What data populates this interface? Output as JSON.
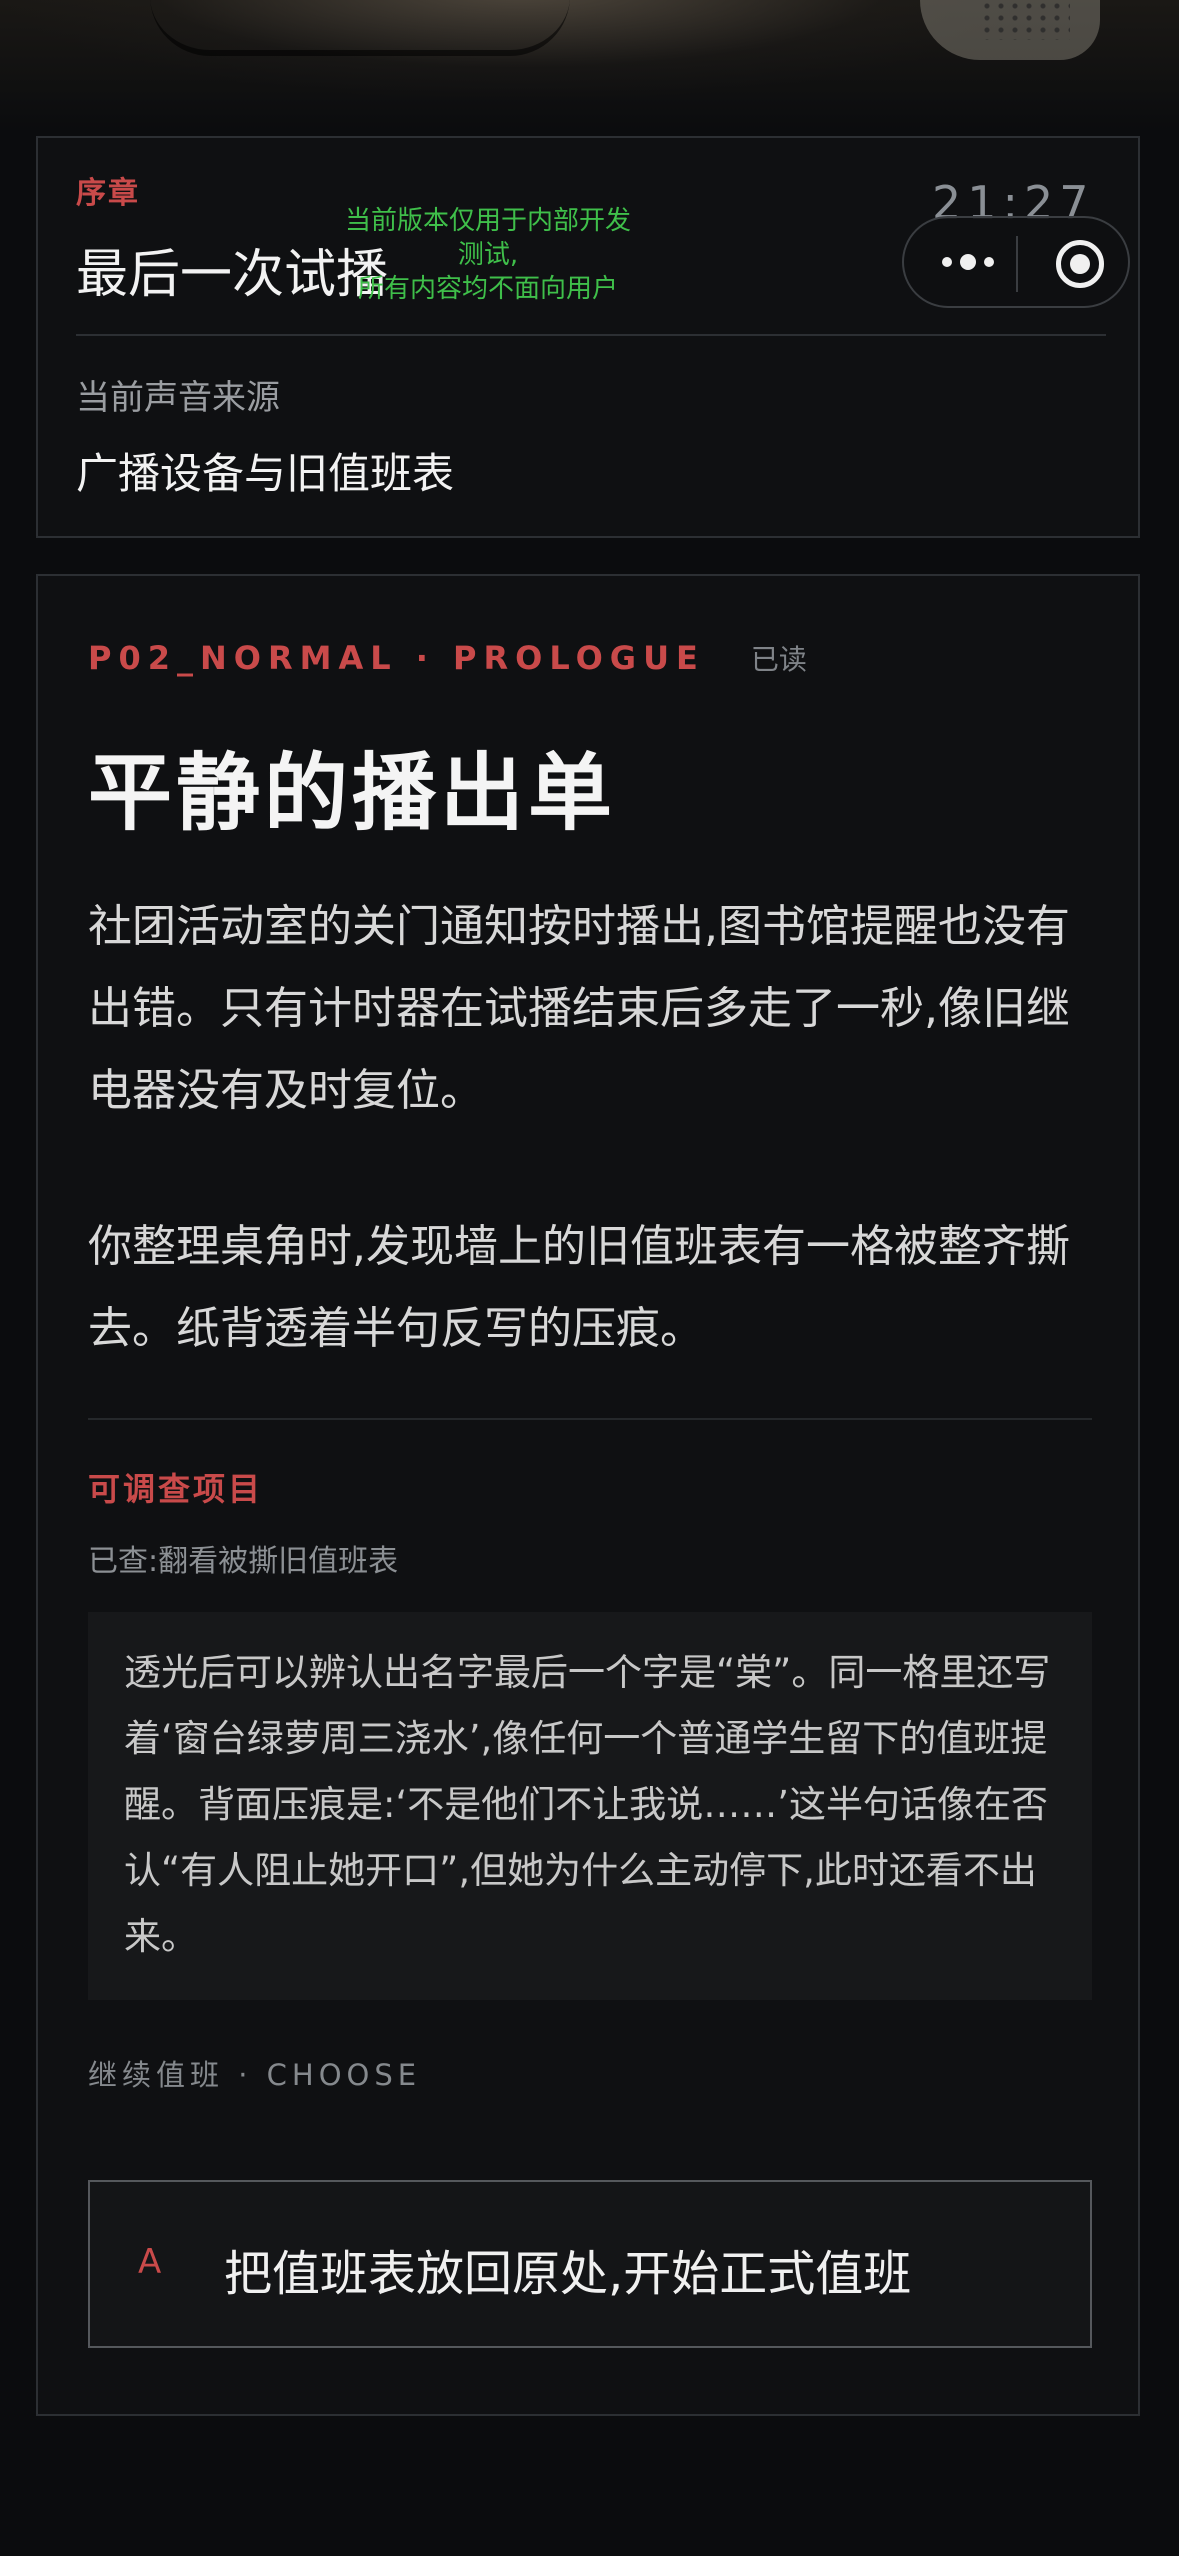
{
  "header": {
    "chapter": "序章",
    "episode_title": "最后一次试播",
    "dev_notice_line1": "当前版本仅用于内部开发测试,",
    "dev_notice_line2": "所有内容均不面向用户",
    "clock": "21:27",
    "source_label": "当前声音来源",
    "source_value": "广播设备与旧值班表"
  },
  "story": {
    "code": "P02_NORMAL · PROLOGUE",
    "read_status": "已读",
    "title": "平静的播出单",
    "paragraph1": "社团活动室的关门通知按时播出,图书馆提醒也没有出错。只有计时器在试播结束后多走了一秒,像旧继电器没有及时复位。",
    "paragraph2": "你整理桌角时,发现墙上的旧值班表有一格被整齐撕去。纸背透着半句反写的压痕。",
    "investigate_title": "可调查项目",
    "checked_line": "已查:翻看被撕旧值班表",
    "note": "透光后可以辨认出名字最后一个字是“棠”。同一格里还写着‘窗台绿萝周三浇水’,像任何一个普通学生留下的值班提醒。背面压痕是:‘不是他们不让我说……’这半句话像在否认“有人阻止她开口”,但她为什么主动停下,此时还看不出来。",
    "choose_label": "继续值班 · CHOOSE",
    "choices": [
      {
        "letter": "A",
        "text": "把值班表放回原处,开始正式值班"
      }
    ]
  }
}
